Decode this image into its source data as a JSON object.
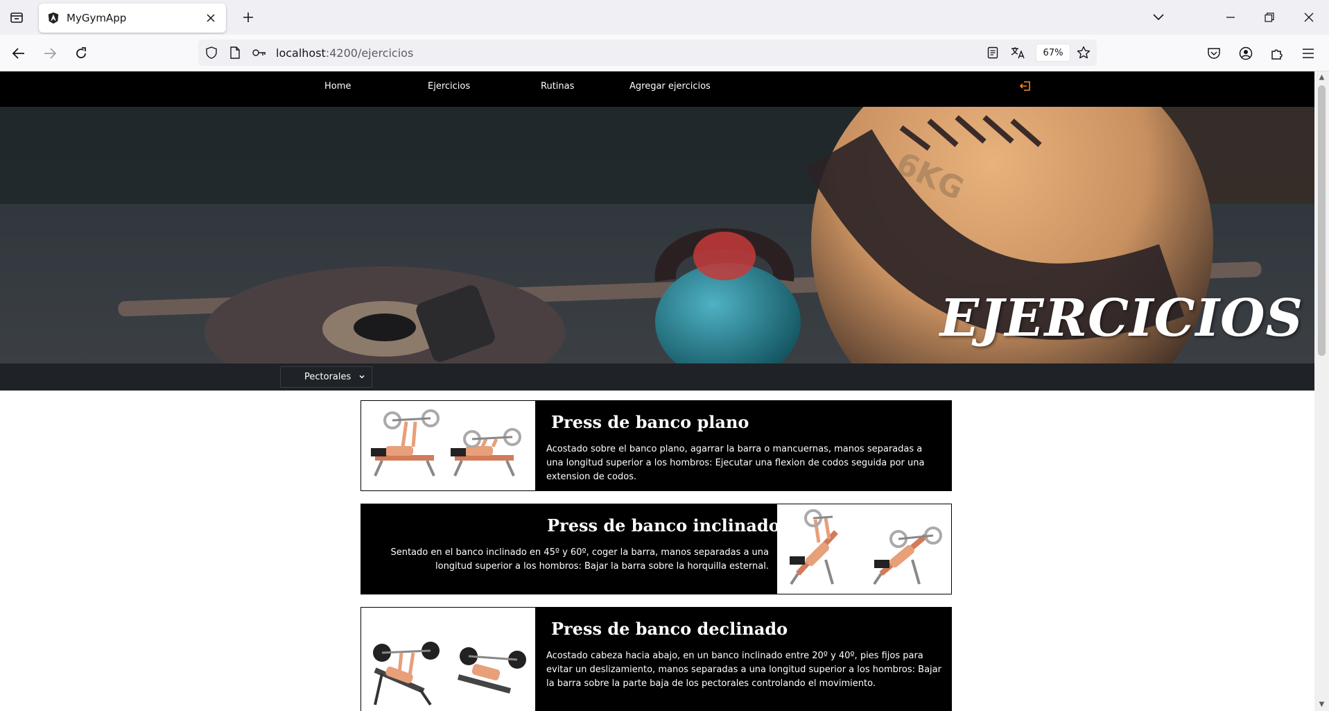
{
  "browser": {
    "tab_title": "MyGymApp",
    "url_host": "localhost",
    "url_path": ":4200/ejercicios",
    "zoom": "67%"
  },
  "site_nav": {
    "links": [
      "Home",
      "Ejercicios",
      "Rutinas",
      "Agregar ejercicios"
    ],
    "accent_color": "#f28c28"
  },
  "hero": {
    "title": "EJERCICIOS"
  },
  "filter": {
    "selected": "Pectorales"
  },
  "exercises": [
    {
      "title": "Press de banco plano",
      "description": "Acostado sobre el banco plano, agarrar la barra o mancuernas, manos separadas a una longitud superior a los hombros: Ejecutar una flexion de codos seguida por una extension de codos."
    },
    {
      "title": "Press de banco inclinado",
      "description": "Sentado en el banco inclinado en 45º y 60º, coger la barra, manos separadas a una longitud superior a los hombros: Bajar la barra sobre la horquilla esternal."
    },
    {
      "title": "Press de banco declinado",
      "description": "Acostado cabeza hacia abajo, en un banco inclinado entre 20º y 40º, pies fijos para evitar un deslizamiento, manos separadas a una longitud superior a los hombros: Bajar la barra sobre la parte baja de los pectorales controlando el movimiento."
    }
  ]
}
